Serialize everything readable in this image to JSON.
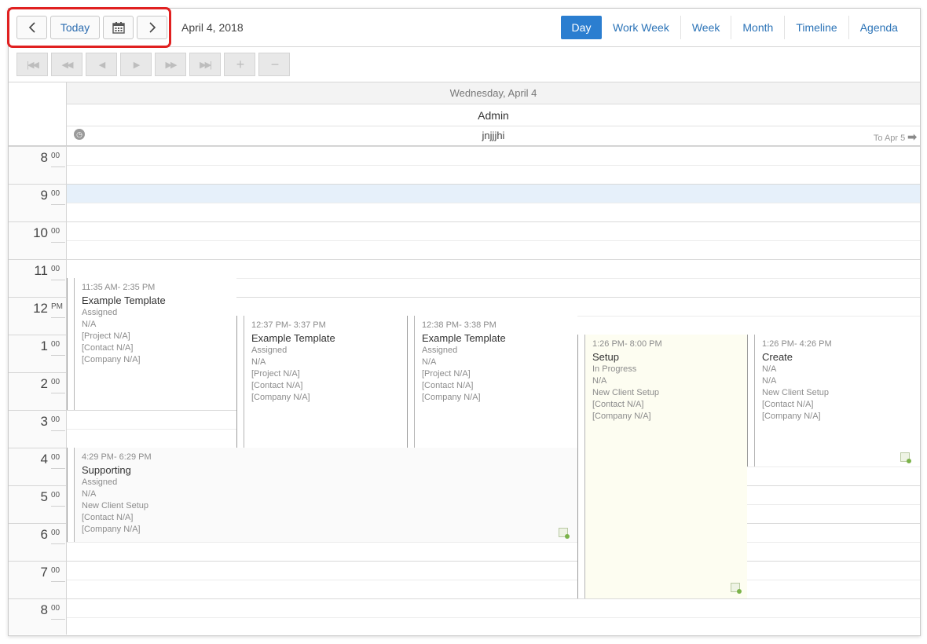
{
  "toolbar": {
    "prev_icon": "chevron-left-icon",
    "today_label": "Today",
    "calendar_icon": "calendar-icon",
    "next_icon": "chevron-right-icon",
    "current_date": "April 4, 2018",
    "views": [
      {
        "label": "Day",
        "active": true
      },
      {
        "label": "Work Week"
      },
      {
        "label": "Week"
      },
      {
        "label": "Month"
      },
      {
        "label": "Timeline"
      },
      {
        "label": "Agenda"
      }
    ]
  },
  "nav_toolbar": {
    "buttons": [
      {
        "name": "first-icon",
        "glyph": "|◀◀"
      },
      {
        "name": "rewind-icon",
        "glyph": "◀◀"
      },
      {
        "name": "step-back-icon",
        "glyph": "◀"
      },
      {
        "name": "step-forward-icon",
        "glyph": "▶"
      },
      {
        "name": "fast-forward-icon",
        "glyph": "▶▶"
      },
      {
        "name": "last-icon",
        "glyph": "▶▶|"
      },
      {
        "name": "zoom-in-icon",
        "glyph": "+"
      },
      {
        "name": "zoom-out-icon",
        "glyph": "−"
      }
    ]
  },
  "header": {
    "day": "Wednesday, April 4",
    "resource": "Admin",
    "all_day_event": "jnjjjhi",
    "to_next": "To Apr 5",
    "to_next_icon": "arrow-right-icon",
    "clock_icon": "clock-icon"
  },
  "hours": [
    {
      "n": "8",
      "m": "00"
    },
    {
      "n": "9",
      "m": "00"
    },
    {
      "n": "10",
      "m": "00"
    },
    {
      "n": "11",
      "m": "00"
    },
    {
      "n": "12",
      "m": "PM"
    },
    {
      "n": "1",
      "m": "00"
    },
    {
      "n": "2",
      "m": "00"
    },
    {
      "n": "3",
      "m": "00"
    },
    {
      "n": "4",
      "m": "00"
    },
    {
      "n": "5",
      "m": "00"
    },
    {
      "n": "6",
      "m": "00"
    },
    {
      "n": "7",
      "m": "00"
    },
    {
      "n": "8",
      "m": "00"
    }
  ],
  "events": [
    {
      "time": "11:35 AM- 2:35 PM",
      "title": "Example Template",
      "lines": [
        "Assigned",
        "N/A",
        "[Project N/A]",
        "[Contact N/A]",
        "[Company N/A]"
      ]
    },
    {
      "time": "12:37 PM- 3:37 PM",
      "title": "Example Template",
      "lines": [
        "Assigned",
        "N/A",
        "[Project N/A]",
        "[Contact N/A]",
        "[Company N/A]"
      ]
    },
    {
      "time": "12:38 PM- 3:38 PM",
      "title": "Example Template",
      "lines": [
        "Assigned",
        "N/A",
        "[Project N/A]",
        "[Contact N/A]",
        "[Company N/A]"
      ]
    },
    {
      "time": "1:26 PM- 8:00 PM",
      "title": "Setup",
      "lines": [
        "In Progress",
        "N/A",
        "New Client Setup",
        "[Contact N/A]",
        "[Company N/A]"
      ]
    },
    {
      "time": "1:26 PM- 4:26 PM",
      "title": "Create",
      "lines": [
        "N/A",
        "N/A",
        "New Client Setup",
        "[Contact N/A]",
        "[Company N/A]"
      ]
    },
    {
      "time": "4:29 PM- 6:29 PM",
      "title": "Supporting",
      "lines": [
        "Assigned",
        "N/A",
        "New Client Setup",
        "[Contact N/A]",
        "[Company N/A]"
      ]
    }
  ],
  "colors": {
    "accent": "#2b7ed0",
    "highlight": "#e02020",
    "selected_slot": "#e6f0fa",
    "event_yellow": "#fdfdf1"
  }
}
